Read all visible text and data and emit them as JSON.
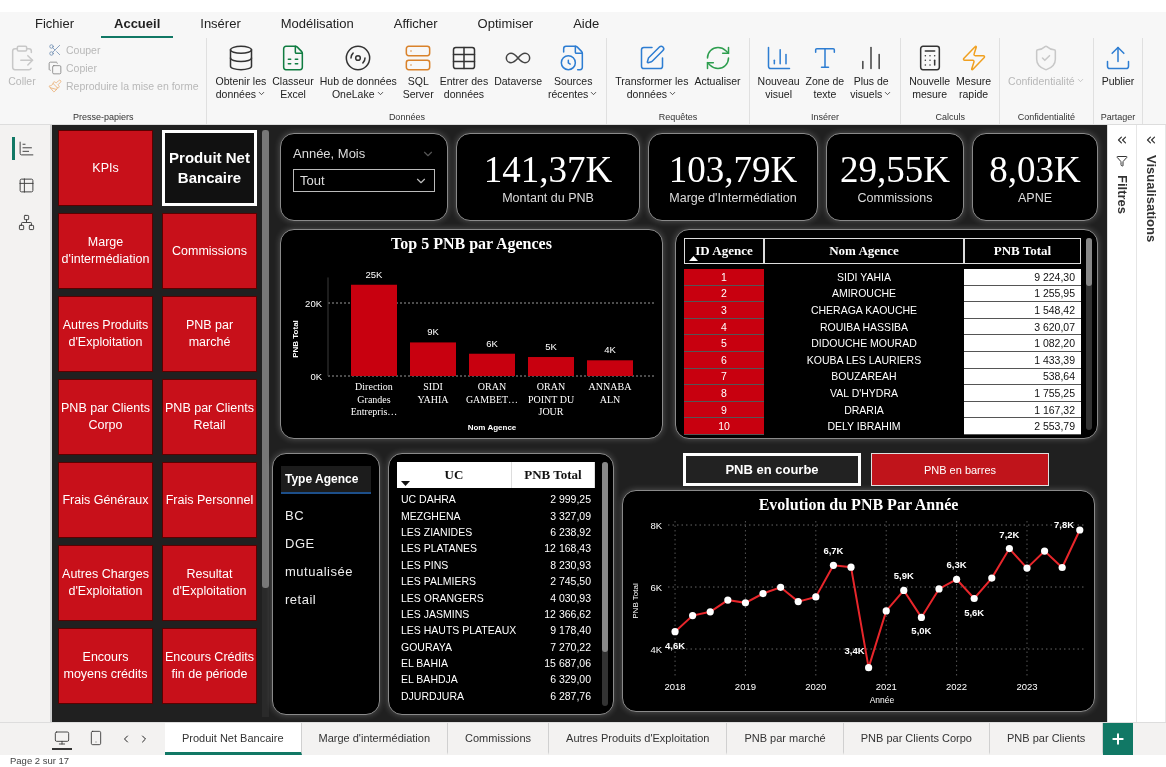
{
  "menu": {
    "tabs": [
      {
        "label": "Fichier",
        "selected": false
      },
      {
        "label": "Accueil",
        "selected": true
      },
      {
        "label": "Insérer",
        "selected": false
      },
      {
        "label": "Modélisation",
        "selected": false
      },
      {
        "label": "Afficher",
        "selected": false
      },
      {
        "label": "Optimiser",
        "selected": false
      },
      {
        "label": "Aide",
        "selected": false
      }
    ]
  },
  "ribbon": {
    "groups": [
      {
        "label": "Presse-papiers",
        "buttons": [
          {
            "kind": "paste",
            "label": "Coller",
            "disabled": true,
            "dropdown": false
          }
        ],
        "small_buttons": [
          {
            "kind": "cut",
            "label": "Couper",
            "disabled": true
          },
          {
            "kind": "copy",
            "label": "Copier",
            "disabled": true
          },
          {
            "kind": "format",
            "label": "Reproduire la mise en forme",
            "disabled": true
          }
        ]
      },
      {
        "label": "Données",
        "buttons": [
          {
            "kind": "getdata",
            "label": "Obtenir les\ndonnées",
            "disabled": false,
            "dropdown": true
          },
          {
            "kind": "excel",
            "label": "Classeur\nExcel",
            "disabled": false,
            "dropdown": false
          },
          {
            "kind": "onelake",
            "label": "Hub de données\nOneLake",
            "disabled": false,
            "dropdown": true
          },
          {
            "kind": "sql",
            "label": "SQL\nServer",
            "disabled": false,
            "dropdown": false
          },
          {
            "kind": "enterdata",
            "label": "Entrer des\ndonnées",
            "disabled": false,
            "dropdown": false
          },
          {
            "kind": "dataverse",
            "label": "Dataverse",
            "disabled": false,
            "dropdown": false
          },
          {
            "kind": "recent",
            "label": "Sources\nrécentes",
            "disabled": false,
            "dropdown": true
          }
        ]
      },
      {
        "label": "Requêtes",
        "buttons": [
          {
            "kind": "transform",
            "label": "Transformer les\ndonnées",
            "disabled": false,
            "dropdown": true
          },
          {
            "kind": "refresh",
            "label": "Actualiser",
            "disabled": false,
            "dropdown": false
          }
        ]
      },
      {
        "label": "Insérer",
        "buttons": [
          {
            "kind": "newvisual",
            "label": "Nouveau\nvisuel",
            "disabled": false,
            "dropdown": false
          },
          {
            "kind": "textbox",
            "label": "Zone de\ntexte",
            "disabled": false,
            "dropdown": false
          },
          {
            "kind": "morevisuals",
            "label": "Plus de\nvisuels",
            "disabled": false,
            "dropdown": true
          }
        ]
      },
      {
        "label": "Calculs",
        "buttons": [
          {
            "kind": "measure",
            "label": "Nouvelle\nmesure",
            "disabled": false,
            "dropdown": false
          },
          {
            "kind": "quickmeasure",
            "label": "Mesure\nrapide",
            "disabled": false,
            "dropdown": false
          }
        ]
      },
      {
        "label": "Confidentialité",
        "buttons": [
          {
            "kind": "sensitivity",
            "label": "Confidentialité",
            "disabled": true,
            "dropdown": true
          }
        ]
      },
      {
        "label": "Partager",
        "buttons": [
          {
            "kind": "publish",
            "label": "Publier",
            "disabled": false,
            "dropdown": false
          }
        ]
      }
    ]
  },
  "views": [
    {
      "kind": "report",
      "selected": true
    },
    {
      "kind": "table",
      "selected": false
    },
    {
      "kind": "model",
      "selected": false
    }
  ],
  "nav": {
    "items": [
      {
        "label": "KPIs",
        "selected": false
      },
      {
        "label": "Marge d'intermédiation",
        "selected": false
      },
      {
        "label": "Autres Produits d'Exploitation",
        "selected": false
      },
      {
        "label": "PNB par Clients Corpo",
        "selected": false
      },
      {
        "label": "Frais Généraux",
        "selected": false
      },
      {
        "label": "Autres Charges d'Exploitation",
        "selected": false
      },
      {
        "label": "Encours moyens crédits",
        "selected": false
      },
      {
        "label": "Produit Net Bancaire",
        "selected": true
      },
      {
        "label": "Commissions",
        "selected": false
      },
      {
        "label": "PNB par marché",
        "selected": false
      },
      {
        "label": "PNB par Clients Retail",
        "selected": false
      },
      {
        "label": "Frais Personnel",
        "selected": false
      },
      {
        "label": "Resultat d'Exploitation",
        "selected": false
      },
      {
        "label": "Encours Crédits fin de période",
        "selected": false
      }
    ]
  },
  "date_slicer": {
    "title": "Année, Mois",
    "value": "Tout"
  },
  "cards": [
    {
      "value": "141,37K",
      "label": "Montant du PNB"
    },
    {
      "value": "103,79K",
      "label": "Marge d'Intermédiation"
    },
    {
      "value": "29,55K",
      "label": "Commissions"
    },
    {
      "value": "8,03K",
      "label": "APNE"
    }
  ],
  "top5": {
    "chart_data": {
      "type": "bar",
      "title": "Top 5 PNB par Agences",
      "xlabel": "Nom Agence",
      "ylabel": "PNB Total",
      "categories": [
        "Direction Grandes Entrepris…",
        "SIDI YAHIA",
        "ORAN GAMBET…",
        "ORAN POINT DU JOUR",
        "ANNABA ALN"
      ],
      "series": [
        {
          "color": "#c8000f",
          "values": [
            25000,
            9200,
            6100,
            5200,
            4300
          ]
        }
      ],
      "ylim": [
        0,
        27000
      ],
      "yticks": [
        {
          "value": 0,
          "label": "0K"
        },
        {
          "value": 20000,
          "label": "20K"
        }
      ],
      "grid": true,
      "value_labels": [
        "25K",
        "9K",
        "6K",
        "5K",
        "4K"
      ]
    }
  },
  "agency_table": {
    "columns": [
      "ID Agence",
      "Nom Agence",
      "PNB Total"
    ],
    "rows": [
      [
        "1",
        "SIDI YAHIA",
        "9 224,30"
      ],
      [
        "2",
        "AMIROUCHE",
        "1 255,95"
      ],
      [
        "3",
        "CHERAGA KAOUCHE",
        "1 548,42"
      ],
      [
        "4",
        "ROUIBA HASSIBA",
        "3 620,07"
      ],
      [
        "5",
        "DIDOUCHE MOURAD",
        "1 082,20"
      ],
      [
        "6",
        "KOUBA LES LAURIERS",
        "1 433,39"
      ],
      [
        "7",
        "BOUZAREAH",
        "538,64"
      ],
      [
        "8",
        "VAL D'HYDRA",
        "1 755,25"
      ],
      [
        "9",
        "DRARIA",
        "1 167,32"
      ],
      [
        "10",
        "DELY IBRAHIM",
        "2 553,79"
      ]
    ]
  },
  "type_slicer": {
    "title": "Type Agence",
    "items": [
      "BC",
      "DGE",
      "mutualisée",
      "retail"
    ]
  },
  "uc_table": {
    "columns": [
      "UC",
      "PNB Total"
    ],
    "rows": [
      [
        "UC DAHRA",
        "2 999,25"
      ],
      [
        "MEZGHENA",
        "3 327,09"
      ],
      [
        "LES ZIANIDES",
        "6 238,92"
      ],
      [
        "LES PLATANES",
        "12 168,43"
      ],
      [
        "LES PINS",
        "8 230,93"
      ],
      [
        "LES PALMIERS",
        "2 745,50"
      ],
      [
        "LES ORANGERS",
        "4 030,93"
      ],
      [
        "LES JASMINS",
        "12 366,62"
      ],
      [
        "LES HAUTS PLATEAUX",
        "9 178,40"
      ],
      [
        "GOURAYA",
        "7 270,22"
      ],
      [
        "EL BAHIA",
        "15 687,06"
      ],
      [
        "EL BAHDJA",
        "6 329,00"
      ],
      [
        "DJURDJURA",
        "6 287,76"
      ]
    ]
  },
  "toggles": [
    {
      "label": "PNB en courbe",
      "selected": true
    },
    {
      "label": "PNB en barres",
      "selected": false
    }
  ],
  "evolution": {
    "chart_data": {
      "type": "line",
      "title": "Evolution du PNB Par Année",
      "xlabel": "Année",
      "ylabel": "PNB Total",
      "x": [
        2018,
        2018.25,
        2018.5,
        2018.75,
        2019,
        2019.25,
        2019.5,
        2019.75,
        2020,
        2020.25,
        2020.5,
        2020.75,
        2021,
        2021.25,
        2021.5,
        2021.75,
        2022,
        2022.25,
        2022.5,
        2022.75,
        2023,
        2023.25,
        2023.5,
        2023.75
      ],
      "series": [
        {
          "color": "#e8262b",
          "marker": "circle",
          "values": [
            4560,
            5080,
            5200,
            5580,
            5490,
            5790,
            5990,
            5530,
            5680,
            6700,
            6640,
            3400,
            5230,
            5890,
            5020,
            5940,
            6250,
            5630,
            6290,
            7240,
            6610,
            7160,
            6630,
            7840
          ]
        }
      ],
      "xlim": [
        2017.9,
        2023.81
      ],
      "ylim": [
        3130,
        8130
      ],
      "grid": true,
      "xticks": [
        2018,
        2019,
        2020,
        2021,
        2022,
        2023
      ],
      "yticks": [
        {
          "value": 4000,
          "label": "4K"
        },
        {
          "value": 6000,
          "label": "6K"
        },
        {
          "value": 8000,
          "label": "8K"
        }
      ],
      "annotations": [
        {
          "x": 2018,
          "y": 4560,
          "text": "4,6K"
        },
        {
          "x": 2020.25,
          "y": 6700,
          "text": "6,7K"
        },
        {
          "x": 2020.75,
          "y": 3400,
          "text": "3,4K"
        },
        {
          "x": 2021.25,
          "y": 5890,
          "text": "5,9K"
        },
        {
          "x": 2021.5,
          "y": 5020,
          "text": "5,0K"
        },
        {
          "x": 2022,
          "y": 6250,
          "text": "6,3K"
        },
        {
          "x": 2022.25,
          "y": 5630,
          "text": "5,6K"
        },
        {
          "x": 2022.75,
          "y": 7240,
          "text": "7,2K"
        },
        {
          "x": 2023.75,
          "y": 7840,
          "text": "7,8K"
        }
      ]
    }
  },
  "panes": [
    {
      "kind": "filters",
      "label": "Filtres"
    },
    {
      "kind": "visualizations",
      "label": "Visualisations"
    }
  ],
  "page_views": [
    {
      "kind": "desktop",
      "selected": true
    },
    {
      "kind": "mobile",
      "selected": false
    }
  ],
  "page_tabs": [
    {
      "label": "Produit Net Bancaire",
      "selected": true
    },
    {
      "label": "Marge d'intermédiation",
      "selected": false
    },
    {
      "label": "Commissions",
      "selected": false
    },
    {
      "label": "Autres Produits d'Exploitation",
      "selected": false
    },
    {
      "label": "PNB par marché",
      "selected": false
    },
    {
      "label": "PNB par Clients Corpo",
      "selected": false
    },
    {
      "label": "PNB par Clients",
      "selected": false
    }
  ],
  "status_bar": {
    "text": "Page 2 sur 17"
  }
}
